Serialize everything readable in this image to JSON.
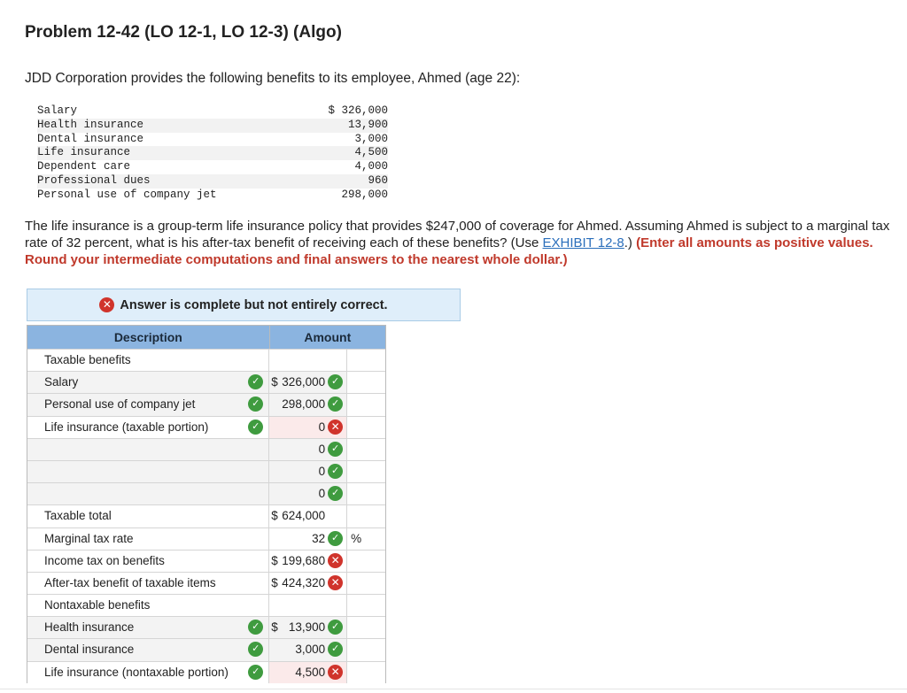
{
  "problem_title": "Problem 12-42 (LO 12-1, LO 12-3) (Algo)",
  "intro": "JDD Corporation provides the following benefits to its employee, Ahmed (age 22):",
  "benefits": [
    {
      "label": "Salary",
      "amount": "$ 326,000"
    },
    {
      "label": "Health insurance",
      "amount": "13,900"
    },
    {
      "label": "Dental insurance",
      "amount": "3,000"
    },
    {
      "label": "Life insurance",
      "amount": "4,500"
    },
    {
      "label": "Dependent care",
      "amount": "4,000"
    },
    {
      "label": "Professional dues",
      "amount": "960"
    },
    {
      "label": "Personal use of company jet",
      "amount": "298,000"
    }
  ],
  "question": {
    "text_before": "The life insurance is a group-term life insurance policy that provides $247,000 of coverage for Ahmed. Assuming Ahmed is subject to a marginal tax rate of 32 percent, what is his after-tax benefit of receiving each of these benefits? (Use ",
    "link": "EXHIBIT 12-8",
    "text_after": ".) ",
    "instructions": "(Enter all amounts as positive values. Round your intermediate computations and final answers to the nearest whole dollar.)"
  },
  "banner": "Answer is complete but not entirely correct.",
  "table": {
    "header_description": "Description",
    "header_amount": "Amount",
    "rows": [
      {
        "desc": "Taxable benefits",
        "desc_check": false,
        "dollar": "",
        "amount": "",
        "status": "",
        "unit": "",
        "bg": ""
      },
      {
        "desc": "Salary",
        "desc_check": true,
        "dollar": "$",
        "amount": "326,000",
        "status": "check",
        "unit": "",
        "bg": "g"
      },
      {
        "desc": "Personal use of company jet",
        "desc_check": true,
        "dollar": "",
        "amount": "298,000",
        "status": "check",
        "unit": "",
        "bg": "g"
      },
      {
        "desc": "Life insurance (taxable portion)",
        "desc_check": true,
        "dollar": "",
        "amount": "0",
        "status": "x",
        "unit": "",
        "bg": "r"
      },
      {
        "desc": "",
        "desc_check": false,
        "dollar": "",
        "amount": "0",
        "status": "check",
        "unit": "",
        "bg": "g"
      },
      {
        "desc": "",
        "desc_check": false,
        "dollar": "",
        "amount": "0",
        "status": "check",
        "unit": "",
        "bg": "g"
      },
      {
        "desc": "",
        "desc_check": false,
        "dollar": "",
        "amount": "0",
        "status": "check",
        "unit": "",
        "bg": "g"
      },
      {
        "desc": "Taxable total",
        "desc_check": false,
        "dollar": "$",
        "amount": "624,000",
        "status": "",
        "unit": "",
        "bg": ""
      },
      {
        "desc": "Marginal tax rate",
        "desc_check": false,
        "dollar": "",
        "amount": "32",
        "status": "check",
        "unit": "%",
        "bg": ""
      },
      {
        "desc": "Income tax on benefits",
        "desc_check": false,
        "dollar": "$",
        "amount": "199,680",
        "status": "x",
        "unit": "",
        "bg": ""
      },
      {
        "desc": "After-tax benefit of taxable items",
        "desc_check": false,
        "dollar": "$",
        "amount": "424,320",
        "status": "x",
        "unit": "",
        "bg": ""
      },
      {
        "desc": "Nontaxable benefits",
        "desc_check": false,
        "dollar": "",
        "amount": "",
        "status": "",
        "unit": "",
        "bg": ""
      },
      {
        "desc": "Health insurance",
        "desc_check": true,
        "dollar": "$",
        "amount": "13,900",
        "status": "check",
        "unit": "",
        "bg": "g"
      },
      {
        "desc": "Dental insurance",
        "desc_check": true,
        "dollar": "",
        "amount": "3,000",
        "status": "check",
        "unit": "",
        "bg": "g"
      },
      {
        "desc": "Life insurance (nontaxable portion)",
        "desc_check": true,
        "dollar": "",
        "amount": "4,500",
        "status": "x",
        "unit": "",
        "bg": "r"
      }
    ]
  }
}
